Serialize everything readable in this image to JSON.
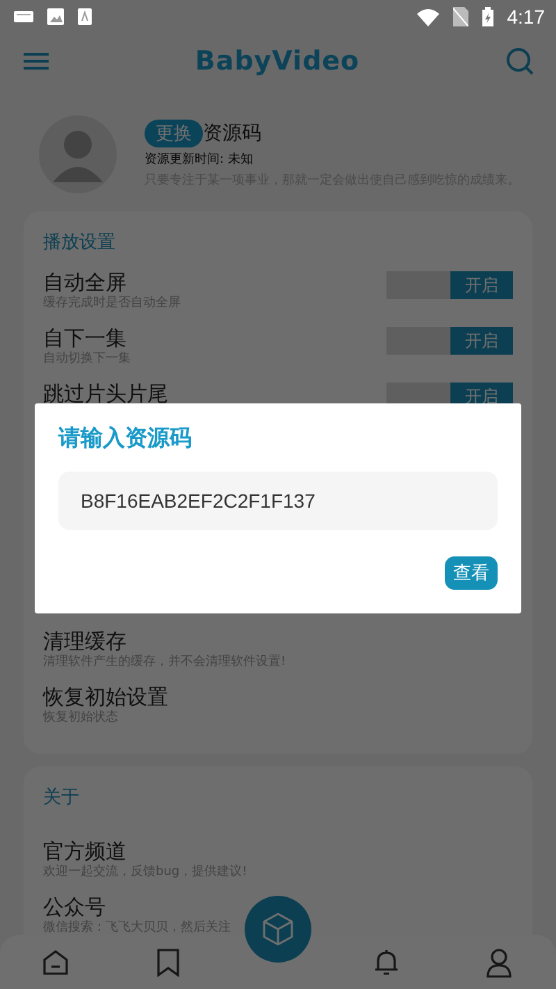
{
  "status_bar": {
    "time": "4:17"
  },
  "top_bar": {
    "title": "BabyVideo"
  },
  "profile": {
    "change_button": "更换",
    "title": "资源码",
    "update_time": "资源更新时间: 未知",
    "motto": "只要专注于某一项事业，那就一定会做出使自己感到吃惊的成绩来。"
  },
  "settings_card": {
    "header": "播放设置",
    "rows": [
      {
        "title": "自动全屏",
        "subtitle": "缓存完成时是否自动全屏",
        "switch_label": "开启",
        "on": true
      },
      {
        "title": "自下一集",
        "subtitle": "自动切换下一集",
        "switch_label": "开启",
        "on": true
      },
      {
        "title": "跳过片头片尾",
        "switch_label": "开启",
        "on": true
      }
    ],
    "more_rows": [
      {
        "title": "清理缓存",
        "subtitle": "清理软件产生的缓存，并不会清理软件设置!"
      },
      {
        "title": "恢复初始设置",
        "subtitle": "恢复初始状态"
      }
    ]
  },
  "about_card": {
    "header": "关于",
    "rows": [
      {
        "title": "官方频道",
        "subtitle": "欢迎一起交流，反馈bug，提供建议!"
      },
      {
        "title": "公众号",
        "subtitle": "微信搜索：飞飞大贝贝，然后关注"
      }
    ]
  },
  "dialog": {
    "title": "请输入资源码",
    "value": "B8F16EAB2EF2C2F1F137",
    "button": "查看"
  }
}
